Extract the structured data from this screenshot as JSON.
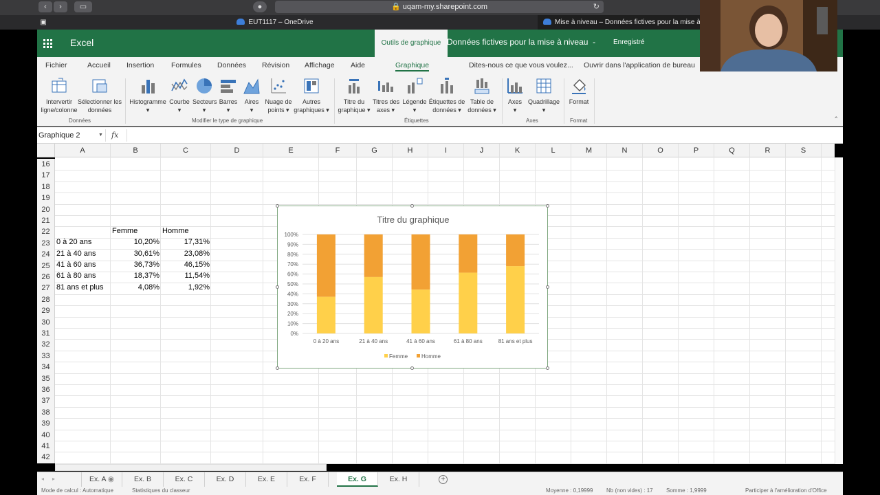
{
  "browser": {
    "url": "uqam-my.sharepoint.com",
    "tabs": [
      {
        "label": "EUT1117 – OneDrive"
      },
      {
        "label": "Mise à niveau – Données fictives pour la mise à n"
      }
    ]
  },
  "app": {
    "name": "Excel",
    "context_tab": "Outils de graphique",
    "doc_title": "Données fictives pour la mise à niveau",
    "separator": "-",
    "save_status": "Enregistré"
  },
  "ribbon_tabs": [
    "Fichier",
    "Accueil",
    "Insertion",
    "Formules",
    "Données",
    "Révision",
    "Affichage",
    "Aide",
    "Graphique",
    "Dites-nous ce que vous voulez...",
    "Ouvrir dans l'application de bureau"
  ],
  "ribbon": {
    "buttons": [
      {
        "line1": "Intervertir",
        "line2": "ligne/colonne"
      },
      {
        "line1": "Sélectionner les",
        "line2": "données"
      },
      {
        "line1": "Histogramme",
        "line2": "▾"
      },
      {
        "line1": "Courbe",
        "line2": "▾"
      },
      {
        "line1": "Secteurs",
        "line2": "▾"
      },
      {
        "line1": "Barres",
        "line2": "▾"
      },
      {
        "line1": "Aires",
        "line2": "▾"
      },
      {
        "line1": "Nuage de",
        "line2": "points ▾"
      },
      {
        "line1": "Autres",
        "line2": "graphiques ▾"
      },
      {
        "line1": "Titre du",
        "line2": "graphique ▾"
      },
      {
        "line1": "Titres des",
        "line2": "axes ▾"
      },
      {
        "line1": "Légende",
        "line2": "▾"
      },
      {
        "line1": "Étiquettes de",
        "line2": "données ▾"
      },
      {
        "line1": "Table de",
        "line2": "données ▾"
      },
      {
        "line1": "Axes",
        "line2": "▾"
      },
      {
        "line1": "Quadrillage",
        "line2": "▾"
      },
      {
        "line1": "Format",
        "line2": ""
      }
    ],
    "groups": [
      "Données",
      "Modifier le type de graphique",
      "Étiquettes",
      "Axes",
      "Format"
    ]
  },
  "formula_bar": {
    "name_box": "Graphique 2",
    "fx": "fx",
    "value": ""
  },
  "columns": [
    "A",
    "B",
    "C",
    "D",
    "E",
    "F",
    "G",
    "H",
    "I",
    "J",
    "K",
    "L",
    "M",
    "N",
    "O",
    "P",
    "Q",
    "R",
    "S"
  ],
  "rows": [
    "16",
    "17",
    "18",
    "19",
    "20",
    "21",
    "22",
    "23",
    "24",
    "25",
    "26",
    "27",
    "28",
    "29",
    "30",
    "31",
    "32",
    "33",
    "34",
    "35",
    "36",
    "37",
    "38",
    "39",
    "40",
    "41",
    "42"
  ],
  "table": {
    "headers": [
      "Femme",
      "Homme"
    ],
    "rows": [
      {
        "label": "0 à 20 ans",
        "femme": "10,20%",
        "homme": "17,31%"
      },
      {
        "label": "21 à 40 ans",
        "femme": "30,61%",
        "homme": "23,08%"
      },
      {
        "label": "41 à 60 ans",
        "femme": "36,73%",
        "homme": "46,15%"
      },
      {
        "label": "61 à 80 ans",
        "femme": "18,37%",
        "homme": "11,54%"
      },
      {
        "label": "81 ans et plus",
        "femme": "4,08%",
        "homme": "1,92%"
      }
    ]
  },
  "chart_data": {
    "type": "bar",
    "stacked": "percent",
    "title": "Titre du graphique",
    "categories": [
      "0 à 20 ans",
      "21 à 40 ans",
      "41 à 60 ans",
      "61 à 80 ans",
      "81 ans et plus"
    ],
    "series": [
      {
        "name": "Femme",
        "values": [
          10.2,
          30.61,
          36.73,
          18.37,
          4.08
        ],
        "color": "#FFD04A"
      },
      {
        "name": "Homme",
        "values": [
          17.31,
          23.08,
          46.15,
          11.54,
          1.92
        ],
        "color": "#F2A134"
      }
    ],
    "ylim": [
      0,
      100
    ],
    "yticks": [
      "0%",
      "10%",
      "20%",
      "30%",
      "40%",
      "50%",
      "60%",
      "70%",
      "80%",
      "90%",
      "100%"
    ],
    "grid": true,
    "legend": "bottom"
  },
  "sheets": [
    "Ex. A",
    "Ex. B",
    "Ex. C",
    "Ex. D",
    "Ex. E",
    "Ex. F",
    "Ex. G",
    "Ex. H"
  ],
  "active_sheet": "Ex. G",
  "status": {
    "calc_mode": "Mode de calcul : Automatique",
    "stats": "Statistiques du classeur",
    "average": "Moyenne : 0,19999",
    "count": "Nb (non vides) : 17",
    "sum": "Somme : 1,9999",
    "feedback": "Participer à l'amélioration d'Office"
  }
}
